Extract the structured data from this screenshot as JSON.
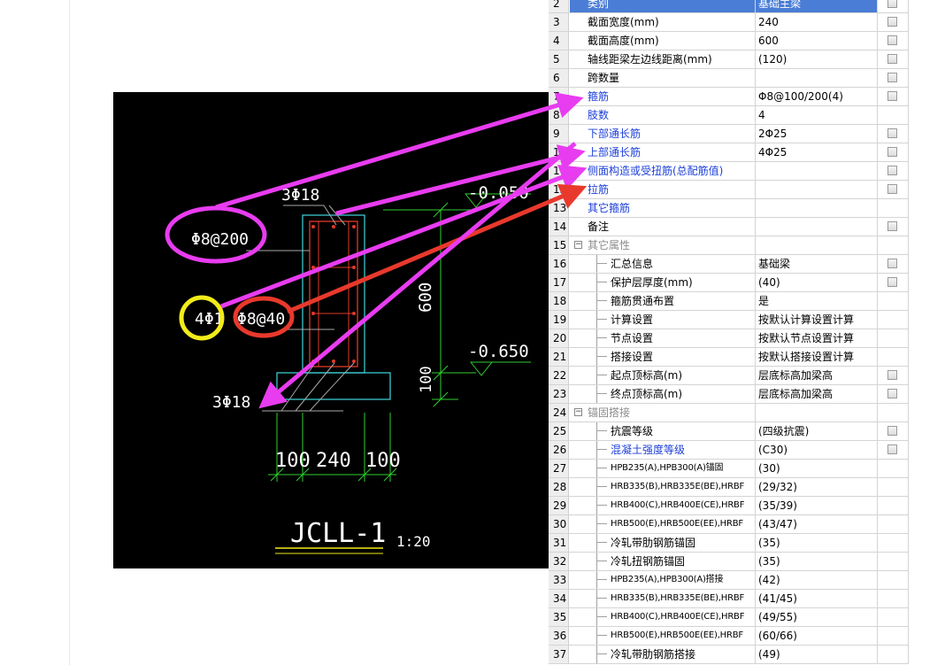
{
  "cad": {
    "top_bars": "3Φ18",
    "stirrup": "Φ8@200",
    "side_bars": "4Φ1",
    "tie_bars": "Φ8@40",
    "bottom_bars": "3Φ18",
    "elev_top": "-0.050",
    "elev_bottom": "-0.650",
    "dim_height": "600",
    "dim_footing": "100",
    "dim_left": "100",
    "dim_width": "240",
    "dim_right": "100",
    "drawing_title": "JCLL-1",
    "scale": "1:20"
  },
  "grid": {
    "rows": [
      {
        "n": "2",
        "name": "类别",
        "value": "基础主梁",
        "chk": true,
        "style": "hl"
      },
      {
        "n": "3",
        "name": "截面宽度(mm)",
        "value": "240",
        "chk": true
      },
      {
        "n": "4",
        "name": "截面高度(mm)",
        "value": "600",
        "chk": true
      },
      {
        "n": "5",
        "name": "轴线距梁左边线距离(mm)",
        "value": "(120)",
        "chk": true
      },
      {
        "n": "6",
        "name": "跨数量",
        "value": "",
        "chk": true
      },
      {
        "n": "7",
        "name": "箍筋",
        "value": "Φ8@100/200(4)",
        "chk": true,
        "style": "blue"
      },
      {
        "n": "8",
        "name": "肢数",
        "value": "4",
        "chk": false,
        "style": "blue"
      },
      {
        "n": "9",
        "name": "下部通长筋",
        "value": "2Φ25",
        "chk": true,
        "style": "blue"
      },
      {
        "n": "10",
        "name": "上部通长筋",
        "value": "4Φ25",
        "chk": true,
        "style": "blue"
      },
      {
        "n": "11",
        "name": "侧面构造或受扭筋(总配筋值)",
        "value": "",
        "chk": true,
        "style": "blue"
      },
      {
        "n": "12",
        "name": "拉筋",
        "value": "",
        "chk": true,
        "style": "blue"
      },
      {
        "n": "13",
        "name": "其它箍筋",
        "value": "",
        "chk": false,
        "style": "blue"
      },
      {
        "n": "14",
        "name": "备注",
        "value": "",
        "chk": true
      },
      {
        "n": "15",
        "name": "其它属性",
        "value": "",
        "chk": false,
        "style": "group"
      },
      {
        "n": "16",
        "name": "汇总信息",
        "value": "基础梁",
        "chk": true,
        "style": "child"
      },
      {
        "n": "17",
        "name": "保护层厚度(mm)",
        "value": "(40)",
        "chk": true,
        "style": "child"
      },
      {
        "n": "18",
        "name": "箍筋贯通布置",
        "value": "是",
        "chk": false,
        "style": "child"
      },
      {
        "n": "19",
        "name": "计算设置",
        "value": "按默认计算设置计算",
        "chk": false,
        "style": "child"
      },
      {
        "n": "20",
        "name": "节点设置",
        "value": "按默认节点设置计算",
        "chk": false,
        "style": "child"
      },
      {
        "n": "21",
        "name": "搭接设置",
        "value": "按默认搭接设置计算",
        "chk": false,
        "style": "child"
      },
      {
        "n": "22",
        "name": "起点顶标高(m)",
        "value": "层底标高加梁高",
        "chk": true,
        "style": "child"
      },
      {
        "n": "23",
        "name": "终点顶标高(m)",
        "value": "层底标高加梁高",
        "chk": true,
        "style": "child"
      },
      {
        "n": "24",
        "name": "锚固搭接",
        "value": "",
        "chk": false,
        "style": "group"
      },
      {
        "n": "25",
        "name": "抗震等级",
        "value": "(四级抗震)",
        "chk": true,
        "style": "child"
      },
      {
        "n": "26",
        "name": "混凝土强度等级",
        "value": "(C30)",
        "chk": true,
        "style": "child-blue"
      },
      {
        "n": "27",
        "name": "HPB235(A),HPB300(A)锚固",
        "value": "(30)",
        "chk": false,
        "style": "child-small"
      },
      {
        "n": "28",
        "name": "HRB335(B),HRB335E(BE),HRBF",
        "value": "(29/32)",
        "chk": false,
        "style": "child-small"
      },
      {
        "n": "29",
        "name": "HRB400(C),HRB400E(CE),HRBF",
        "value": "(35/39)",
        "chk": false,
        "style": "child-small"
      },
      {
        "n": "30",
        "name": "HRB500(E),HRB500E(EE),HRBF",
        "value": "(43/47)",
        "chk": false,
        "style": "child-small"
      },
      {
        "n": "31",
        "name": "冷轧带肋钢筋锚固",
        "value": "(35)",
        "chk": false,
        "style": "child"
      },
      {
        "n": "32",
        "name": "冷轧扭钢筋锚固",
        "value": "(35)",
        "chk": false,
        "style": "child"
      },
      {
        "n": "33",
        "name": "HPB235(A),HPB300(A)搭接",
        "value": "(42)",
        "chk": false,
        "style": "child-small"
      },
      {
        "n": "34",
        "name": "HRB335(B),HRB335E(BE),HRBF",
        "value": "(41/45)",
        "chk": false,
        "style": "child-small"
      },
      {
        "n": "35",
        "name": "HRB400(C),HRB400E(CE),HRBF",
        "value": "(49/55)",
        "chk": false,
        "style": "child-small"
      },
      {
        "n": "36",
        "name": "HRB500(E),HRB500E(EE),HRBF",
        "value": "(60/66)",
        "chk": false,
        "style": "child-small"
      },
      {
        "n": "37",
        "name": "冷轧带肋钢筋搭接",
        "value": "(49)",
        "chk": false,
        "style": "child"
      }
    ]
  },
  "colors": {
    "magenta": "#e83cf0",
    "yellow": "#f2ec1a",
    "red": "#e8392c",
    "cad_green": "#2fd12f",
    "cad_cyan": "#3fd9e0",
    "rebar_red": "#e03a2a",
    "label_blue": "#1c3fd9"
  }
}
